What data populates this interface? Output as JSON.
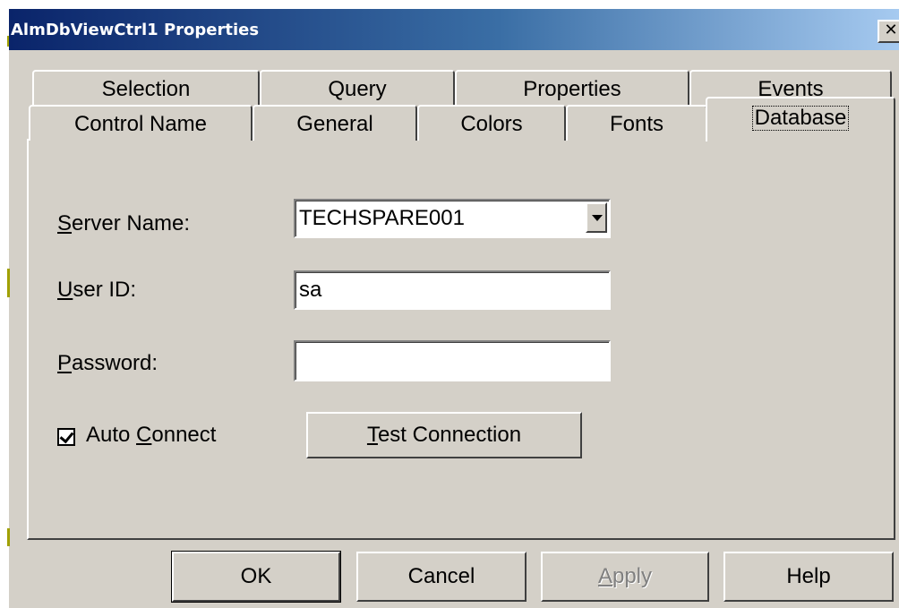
{
  "window": {
    "title": "AlmDbViewCtrl1 Properties",
    "close_label": "✕"
  },
  "tabs_row1": [
    {
      "label": "Selection"
    },
    {
      "label": "Query"
    },
    {
      "label": "Properties"
    },
    {
      "label": "Events"
    }
  ],
  "tabs_row2": [
    {
      "label": "Control Name"
    },
    {
      "label": "General"
    },
    {
      "label": "Colors"
    },
    {
      "label": "Fonts"
    },
    {
      "label": "Database",
      "selected": true
    }
  ],
  "form": {
    "server_name": {
      "mnemonic": "S",
      "label_rest": "erver Name:",
      "value": "TECHSPARE001"
    },
    "user_id": {
      "mnemonic": "U",
      "label_rest": "ser ID:",
      "value": "sa"
    },
    "password": {
      "mnemonic": "P",
      "label_rest": "assword:",
      "value": ""
    },
    "auto_connect": {
      "label_pre": "Auto ",
      "mnemonic": "C",
      "label_rest": "onnect",
      "checked": true
    },
    "test_connection": {
      "mnemonic": "T",
      "label_rest": "est Connection"
    }
  },
  "buttons": {
    "ok": "OK",
    "cancel": "Cancel",
    "apply": {
      "mnemonic": "A",
      "label_rest": "pply"
    },
    "help": "Help"
  },
  "icons": {
    "close": "close-icon",
    "dropdown": "chevron-down-icon",
    "checkbox": "check-icon"
  }
}
